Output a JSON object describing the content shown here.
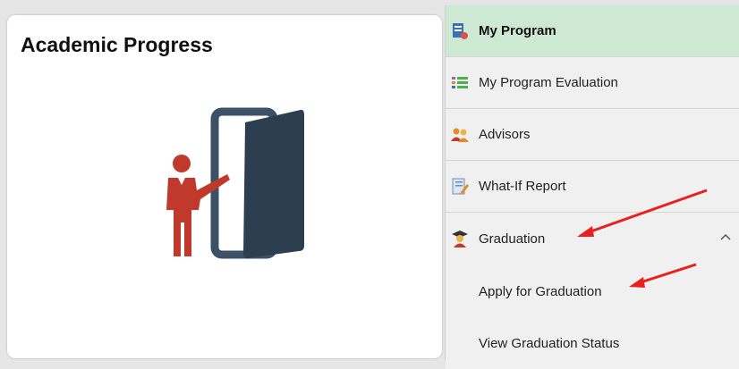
{
  "tile": {
    "title": "Academic Progress",
    "icon": "teacher-door-icon"
  },
  "menu": {
    "items": [
      {
        "label": "My Program",
        "icon": "program-icon",
        "active": true
      },
      {
        "label": "My Program Evaluation",
        "icon": "list-icon"
      },
      {
        "label": "Advisors",
        "icon": "people-icon"
      },
      {
        "label": "What-If Report",
        "icon": "report-edit-icon"
      },
      {
        "label": "Graduation",
        "icon": "graduate-icon",
        "expanded": true
      }
    ],
    "subitems": [
      {
        "label": "Apply for Graduation"
      },
      {
        "label": "View Graduation Status"
      }
    ]
  },
  "colors": {
    "active_bg": "#cde9d3",
    "annotation_arrow": "#e8211f",
    "door": "#2c3e50",
    "figure": "#c0392b"
  }
}
